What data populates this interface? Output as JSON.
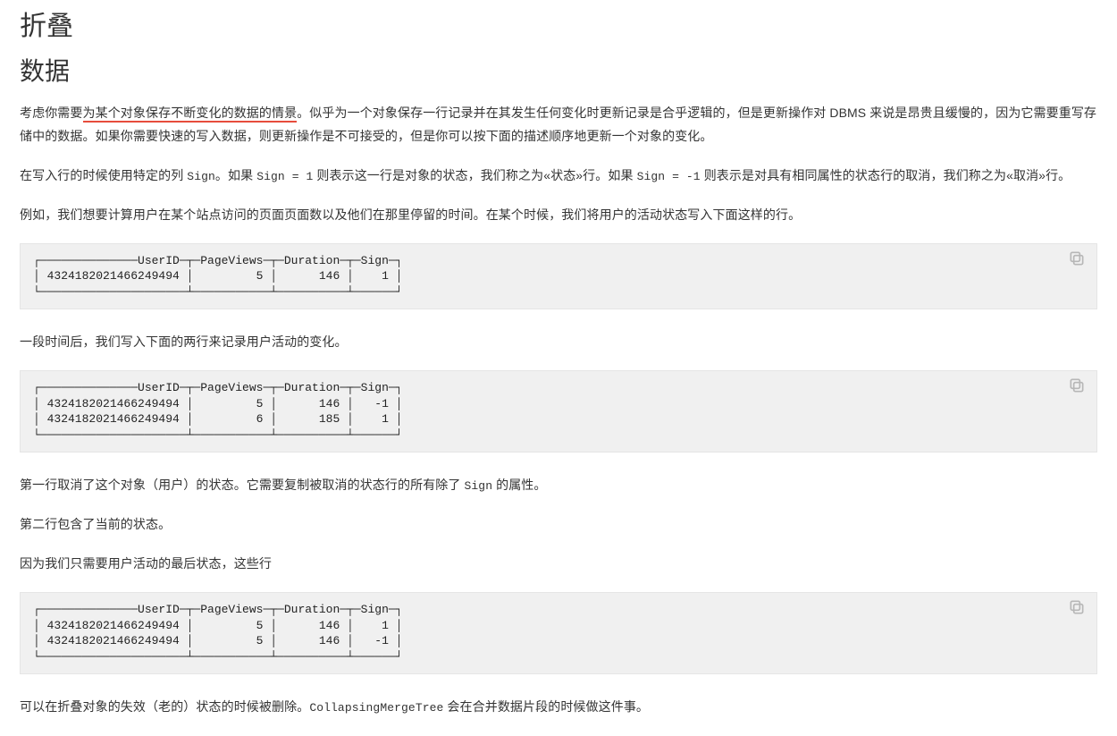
{
  "headings": {
    "h1": "折叠",
    "h2": "数据"
  },
  "para1": {
    "pre": "考虑你需要",
    "underlined": "为某个对象保存不断变化的数据的情景",
    "post": "。似乎为一个对象保存一行记录并在其发生任何变化时更新记录是合乎逻辑的，但是更新操作对 DBMS 来说是昂贵且缓慢的，因为它需要重写存储中的数据。如果你需要快速的写入数据，则更新操作是不可接受的，但是你可以按下面的描述顺序地更新一个对象的变化。"
  },
  "para2": {
    "a": "在写入行的时候使用特定的列 ",
    "code1": "Sign",
    "b": "。如果 ",
    "code2": "Sign = 1",
    "c": " 则表示这一行是对象的状态，我们称之为«状态»行。如果 ",
    "code3": "Sign = -1",
    "d": " 则表示是对具有相同属性的状态行的取消，我们称之为«取消»行。"
  },
  "para3": "例如，我们想要计算用户在某个站点访问的页面页面数以及他们在那里停留的时间。在某个时候，我们将用户的活动状态写入下面这样的行。",
  "code1": "┌──────────────UserID─┬─PageViews─┬─Duration─┬─Sign─┐\n│ 4324182021466249494 │         5 │      146 │    1 │\n└─────────────────────┴───────────┴──────────┴──────┘",
  "para4": "一段时间后，我们写入下面的两行来记录用户活动的变化。",
  "code2": "┌──────────────UserID─┬─PageViews─┬─Duration─┬─Sign─┐\n│ 4324182021466249494 │         5 │      146 │   -1 │\n│ 4324182021466249494 │         6 │      185 │    1 │\n└─────────────────────┴───────────┴──────────┴──────┘",
  "para5": {
    "a": "第一行取消了这个对象（用户）的状态。它需要复制被取消的状态行的所有除了 ",
    "code": "Sign",
    "b": " 的属性。"
  },
  "para6": "第二行包含了当前的状态。",
  "para7": "因为我们只需要用户活动的最后状态，这些行",
  "code3": "┌──────────────UserID─┬─PageViews─┬─Duration─┬─Sign─┐\n│ 4324182021466249494 │         5 │      146 │    1 │\n│ 4324182021466249494 │         5 │      146 │   -1 │\n└─────────────────────┴───────────┴──────────┴──────┘",
  "para8": {
    "a": "可以在折叠对象的失效（老的）状态的时候被删除。",
    "code": "CollapsingMergeTree",
    "b": " 会在合并数据片段的时候做这件事。"
  }
}
